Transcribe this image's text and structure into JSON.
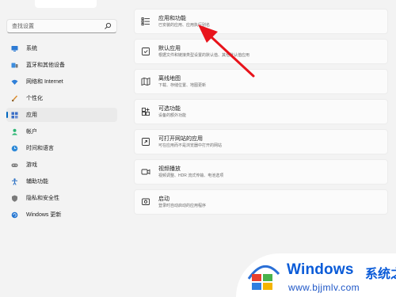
{
  "search": {
    "placeholder": "查找设置"
  },
  "sidebar": {
    "items": [
      {
        "label": "系统",
        "icon": "monitor-icon"
      },
      {
        "label": "蓝牙和其他设备",
        "icon": "bluetooth-devices-icon"
      },
      {
        "label": "网络和 Internet",
        "icon": "wifi-icon"
      },
      {
        "label": "个性化",
        "icon": "brush-icon"
      },
      {
        "label": "应用",
        "icon": "apps-icon",
        "active": true
      },
      {
        "label": "帐户",
        "icon": "person-icon"
      },
      {
        "label": "时间和语言",
        "icon": "globe-clock-icon"
      },
      {
        "label": "游戏",
        "icon": "gamepad-icon"
      },
      {
        "label": "辅助功能",
        "icon": "accessibility-icon"
      },
      {
        "label": "隐私和安全性",
        "icon": "shield-icon"
      },
      {
        "label": "Windows 更新",
        "icon": "update-icon"
      }
    ]
  },
  "main": {
    "cards": [
      {
        "title": "应用和功能",
        "desc": "已安装的应用、应用执行别名",
        "icon": "apps-list-icon"
      },
      {
        "title": "默认应用",
        "desc": "根据文件和链接类型设置的默认值、其他默认值应用",
        "icon": "default-apps-icon"
      },
      {
        "title": "离线地图",
        "desc": "下载、存储位置、地图更新",
        "icon": "map-icon"
      },
      {
        "title": "可选功能",
        "desc": "设备的额外功能",
        "icon": "optional-features-icon"
      },
      {
        "title": "可打开网站的应用",
        "desc": "可在应用而不是浏览器中打开的网站",
        "icon": "website-apps-icon"
      },
      {
        "title": "视频播放",
        "desc": "视频调整、HDR 流式传输、电池选项",
        "icon": "video-icon"
      },
      {
        "title": "启动",
        "desc": "登录时自动启动的应用程序",
        "icon": "startup-icon"
      }
    ]
  },
  "watermark": {
    "brand": "Windows",
    "brand_cn": "系统之家",
    "url": "www.bjjmlv.com"
  },
  "colors": {
    "accent": "#0067c0",
    "arrow": "#e8131b",
    "watermark_blue": "#0a5bd8"
  }
}
